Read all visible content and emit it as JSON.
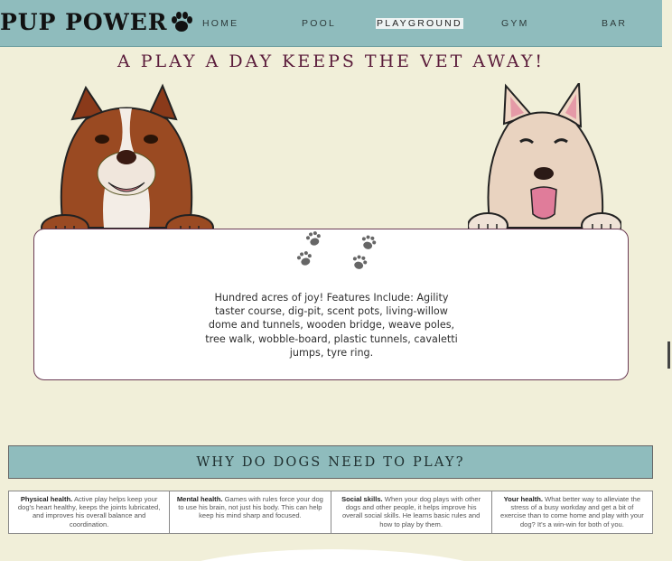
{
  "brand": {
    "name": "PUP POWER",
    "icon": "paw-icon"
  },
  "nav": {
    "items": [
      {
        "label": "HOME",
        "active": false
      },
      {
        "label": "POOL",
        "active": false
      },
      {
        "label": "PLAYGROUND",
        "active": true
      },
      {
        "label": "GYM",
        "active": false
      },
      {
        "label": "BAR",
        "active": false
      }
    ]
  },
  "hero": {
    "tagline": "A PLAY A DAY KEEPS THE VET AWAY!",
    "card_text": "Hundred acres of joy! Features Include: Agility taster course, dig-pit, scent pots, living-willow dome and tunnels, wooden bridge, weave poles, tree walk, wobble-board, plastic tunnels, cavaletti jumps, tyre ring."
  },
  "why": {
    "title": "WHY DO DOGS NEED TO PLAY?",
    "reasons": [
      {
        "title": "Physical health.",
        "text": " Active play helps keep your dog's heart healthy, keeps the joints lubricated, and improves his overall balance and coordination."
      },
      {
        "title": "Mental health.",
        "text": " Games with rules force your dog to use his brain, not just his body. This can help keep his mind sharp and focused."
      },
      {
        "title": "Social skills.",
        "text": " When your dog plays with other dogs and other people, it helps improve his overall social skills. He learns basic rules and how to play by them."
      },
      {
        "title": "Your health.",
        "text": " What better way to alleviate the stress of a busy workday and get a bit of exercise than to come home and play with your dog? It's a win-win for both of you."
      }
    ]
  },
  "colors": {
    "nav_bg": "#8fbcbd",
    "page_bg": "#f1efd9",
    "accent": "#5a1b3a"
  }
}
